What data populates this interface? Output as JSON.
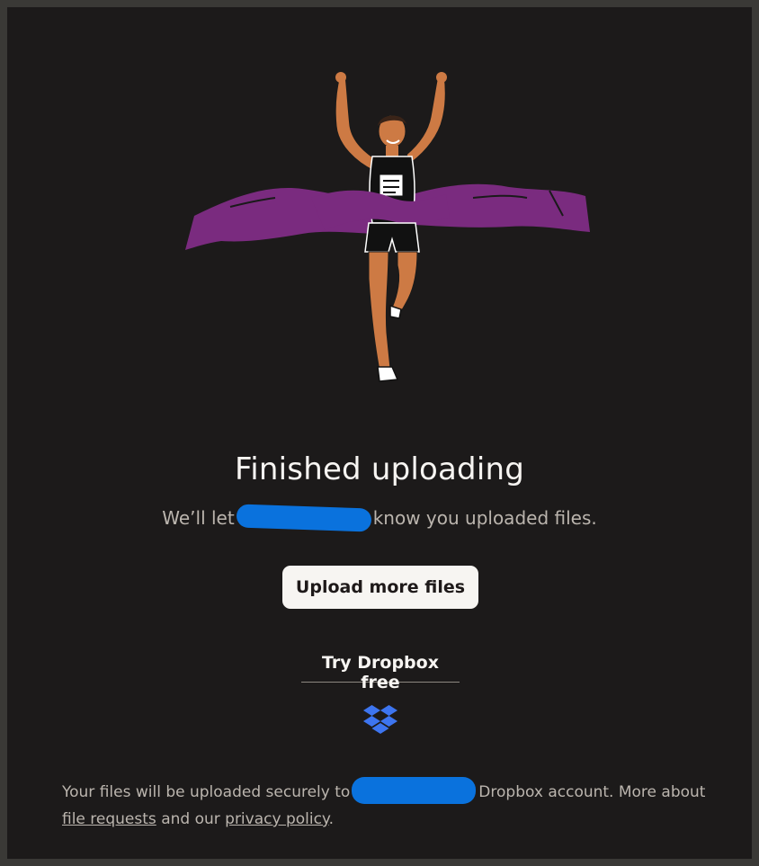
{
  "main": {
    "title": "Finished uploading",
    "subtitle_before": "We’ll let",
    "subtitle_after": "know you uploaded files.",
    "upload_more_label": "Upload more files",
    "try_dropbox_label": "Try Dropbox free"
  },
  "footer": {
    "text_before": "Your files will be uploaded securely to",
    "text_middle": "Dropbox account. More about",
    "file_requests_link": "file requests",
    "text_and": "and our",
    "privacy_link": "privacy policy",
    "text_end": "."
  },
  "colors": {
    "background": "#1c1a1a",
    "button_bg": "#f7f5f2",
    "ribbon": "#7a2b7f",
    "skin": "#cd7a44",
    "dropbox_blue": "#3d75f0",
    "redaction": "#0a72dd"
  },
  "icons": {
    "logo": "dropbox-logo-icon",
    "illustration": "runner-finish-line-illustration"
  }
}
